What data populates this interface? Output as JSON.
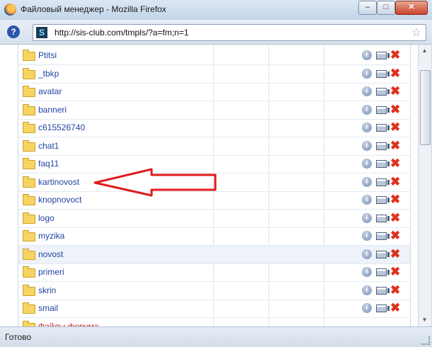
{
  "window": {
    "title": "Файловый менеджер - Mozilla Firefox",
    "min_label": "–",
    "max_label": "□",
    "close_label": "✕"
  },
  "navbar": {
    "help_glyph": "?",
    "site_icon_glyph": "S",
    "url": "http://sis-club.com/tmpls/?a=fm;n=1",
    "bookmark_glyph": "☆"
  },
  "files": [
    {
      "name": "Ptitsi"
    },
    {
      "name": "_tbkp"
    },
    {
      "name": "avatar"
    },
    {
      "name": "banneri"
    },
    {
      "name": "c615526740"
    },
    {
      "name": "chat1"
    },
    {
      "name": "faq11"
    },
    {
      "name": "kartinovost"
    },
    {
      "name": "knopnovoct"
    },
    {
      "name": "logo"
    },
    {
      "name": "myzika"
    },
    {
      "name": "novost",
      "highlighted": true
    },
    {
      "name": "primeri"
    },
    {
      "name": "skrin"
    },
    {
      "name": "smail"
    },
    {
      "name": "Файлы форума",
      "red": true
    }
  ],
  "row_icons": {
    "info_glyph": "i",
    "delete_glyph": "✖"
  },
  "scrollbar": {
    "up_glyph": "▲",
    "down_glyph": "▼"
  },
  "status": {
    "text": "Готово"
  },
  "colors": {
    "link": "#2244a0",
    "arrow": "#e01c1c",
    "delete": "#e0301e"
  }
}
